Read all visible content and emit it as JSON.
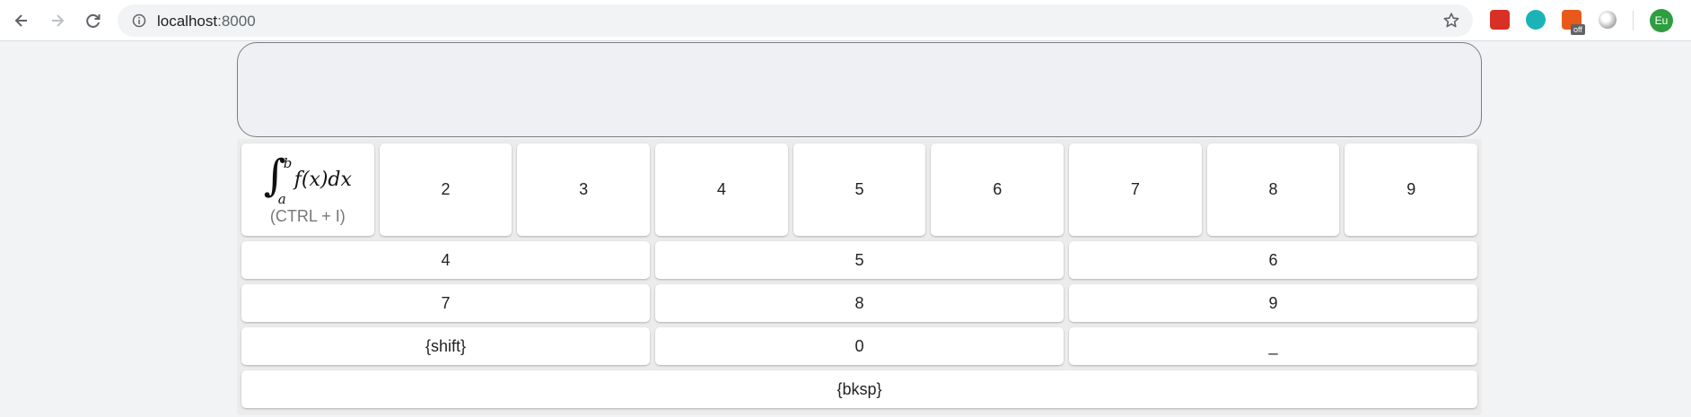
{
  "browser": {
    "url_host": "localhost",
    "url_port": ":8000",
    "ext_badge": "off",
    "profile_initials": "Eu",
    "colors": {
      "ext1": "#d93025",
      "ext2": "#1bb3b6",
      "ext3": "#e8591a",
      "ext4": "#bdbdbd",
      "avatar": "#2e9e40"
    }
  },
  "keyboard": {
    "integral_key": {
      "symbol": "∫",
      "upper": "b",
      "lower": "a",
      "body": "f(x)dx",
      "shortcut": "(CTRL + I)"
    },
    "row1": [
      "2",
      "3",
      "4",
      "5",
      "6",
      "7",
      "8",
      "9"
    ],
    "row2": [
      "4",
      "5",
      "6"
    ],
    "row3": [
      "7",
      "8",
      "9"
    ],
    "row4": [
      "{shift}",
      "0",
      "_"
    ],
    "row5": [
      "{bksp}"
    ]
  }
}
